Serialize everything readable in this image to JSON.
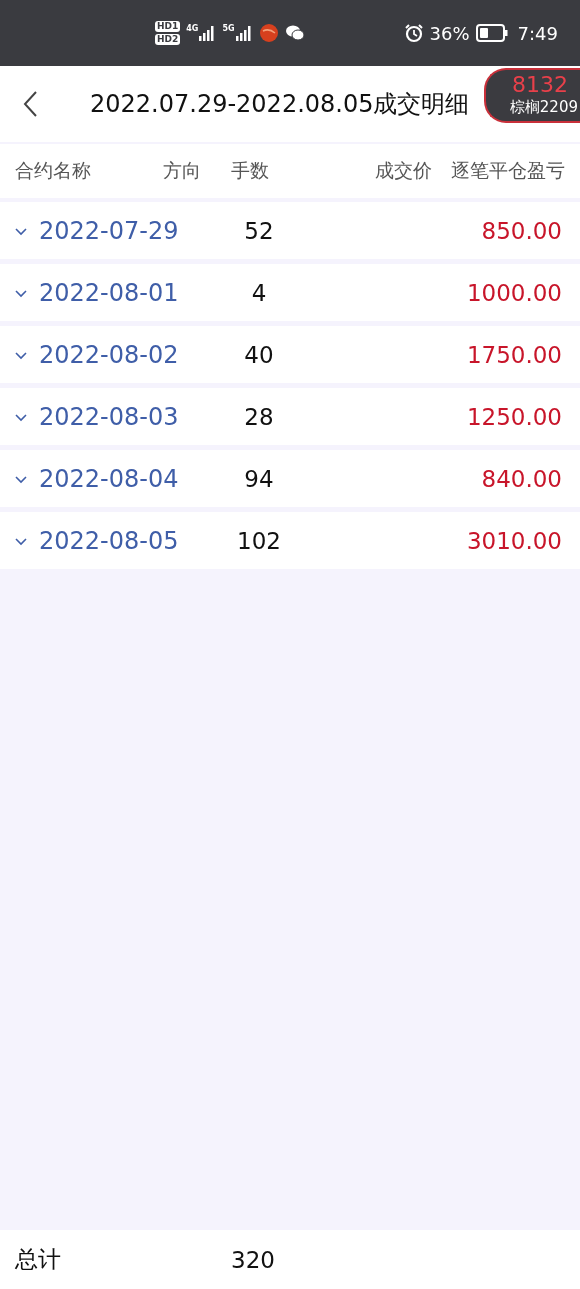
{
  "status_bar": {
    "sims": [
      "HD1",
      "HD2"
    ],
    "networks": [
      "4G",
      "5G"
    ],
    "battery_percent": "36%",
    "time": "7:49"
  },
  "header": {
    "title": "2022.07.29-2022.08.05成交明细"
  },
  "floating_quote": {
    "price": "8132",
    "contract": "棕榈2209"
  },
  "table": {
    "columns": [
      "合约名称",
      "方向",
      "手数",
      "成交价",
      "逐笔平仓盈亏"
    ],
    "rows": [
      {
        "date": "2022-07-29",
        "lots": "52",
        "pnl": "850.00",
        "expanded": false
      },
      {
        "date": "2022-08-01",
        "lots": "4",
        "pnl": "1000.00",
        "expanded": false
      },
      {
        "date": "2022-08-02",
        "lots": "40",
        "pnl": "1750.00",
        "expanded": false
      },
      {
        "date": "2022-08-03",
        "lots": "28",
        "pnl": "1250.00",
        "expanded": false
      },
      {
        "date": "2022-08-04",
        "lots": "94",
        "pnl": "840.00",
        "expanded": false
      },
      {
        "date": "2022-08-05",
        "lots": "102",
        "pnl": "3010.00",
        "expanded": false
      }
    ]
  },
  "footer": {
    "label": "总计",
    "lots": "320"
  }
}
